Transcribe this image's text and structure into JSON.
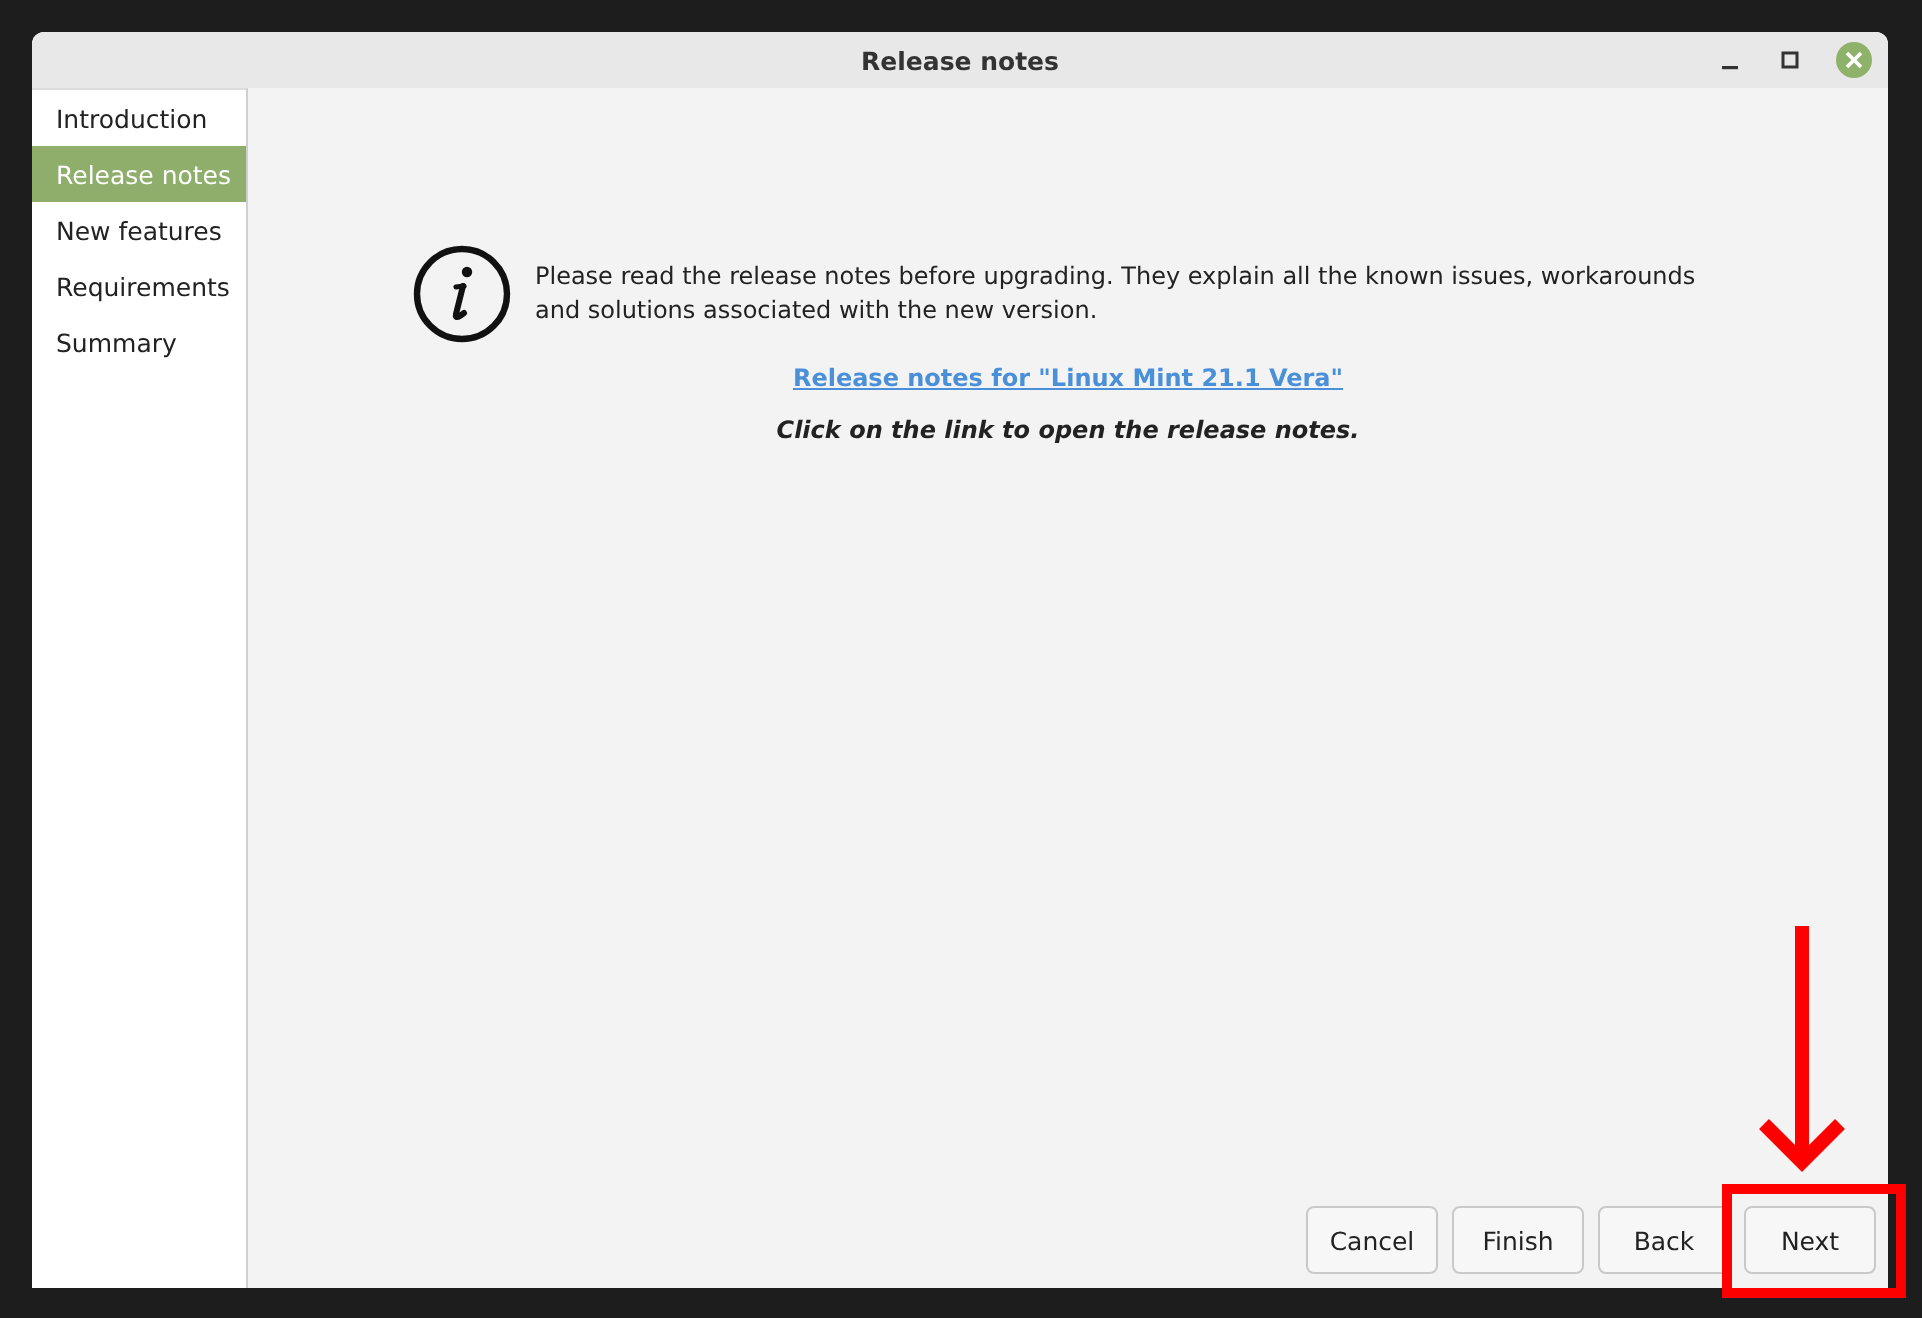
{
  "window": {
    "title": "Release notes"
  },
  "sidebar": {
    "items": [
      {
        "label": "Introduction",
        "selected": false
      },
      {
        "label": "Release notes",
        "selected": true
      },
      {
        "label": "New features",
        "selected": false
      },
      {
        "label": "Requirements",
        "selected": false
      },
      {
        "label": "Summary",
        "selected": false
      }
    ]
  },
  "content": {
    "message": "Please read the release notes before upgrading. They explain all the known issues, workarounds and solutions associated with the new version.",
    "link": "Release notes for \"Linux Mint 21.1 Vera\"",
    "hint": "Click on the link to open the release notes."
  },
  "buttons": [
    {
      "label": "Cancel"
    },
    {
      "label": "Finish"
    },
    {
      "label": "Back"
    },
    {
      "label": "Next"
    }
  ],
  "annotation": {
    "arrow": true,
    "box": true
  }
}
